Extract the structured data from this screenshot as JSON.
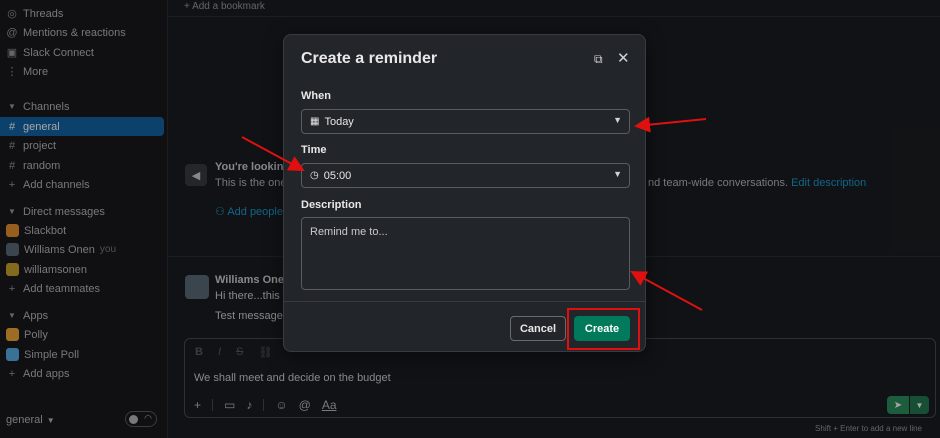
{
  "sidebar": {
    "top_items": [
      {
        "icon": "threads-icon",
        "glyph": "◎",
        "label": "Threads"
      },
      {
        "icon": "at-icon",
        "glyph": "@",
        "label": "Mentions & reactions"
      },
      {
        "icon": "connect-icon",
        "glyph": "▣",
        "label": "Slack Connect"
      },
      {
        "icon": "more-icon",
        "glyph": "⋮",
        "label": "More"
      }
    ],
    "channels_header": "Channels",
    "channels": [
      "general",
      "project",
      "random"
    ],
    "add_channels": "Add channels",
    "dm_header": "Direct messages",
    "dms": [
      {
        "label": "Slackbot",
        "color": "#e8912d"
      },
      {
        "label": "Williams Onen",
        "suffix": "you",
        "color": "#5b6b78"
      },
      {
        "label": "williamsonen",
        "color": "#c9a42b"
      }
    ],
    "add_teammates": "Add teammates",
    "apps_header": "Apps",
    "apps": [
      {
        "label": "Polly",
        "color": "#f2a63a"
      },
      {
        "label": "Simple Poll",
        "color": "#5ab0e8"
      }
    ],
    "add_apps": "Add apps",
    "footer_channel": "general"
  },
  "main": {
    "bookmark": "Add a bookmark",
    "intro_title": "You're looking",
    "intro_text": "This is the one",
    "intro_text_right": "nd team-wide conversations.",
    "edit_description": "Edit description",
    "add_people": "Add people",
    "message": {
      "author": "Williams Onen",
      "text": "Hi there...this is",
      "text2": "Test message 2"
    },
    "composer": {
      "text": "We shall meet and decide on the budget",
      "hint": "Shift + Enter to add a new line"
    }
  },
  "modal": {
    "title": "Create a reminder",
    "when_label": "When",
    "when_value": "Today",
    "time_label": "Time",
    "time_value": "05:00",
    "description_label": "Description",
    "description_placeholder": "Remind me to...",
    "cancel_label": "Cancel",
    "create_label": "Create"
  },
  "colors": {
    "accent": "#1164a3",
    "create_button": "#007a5a",
    "annotation": "#e01010"
  }
}
